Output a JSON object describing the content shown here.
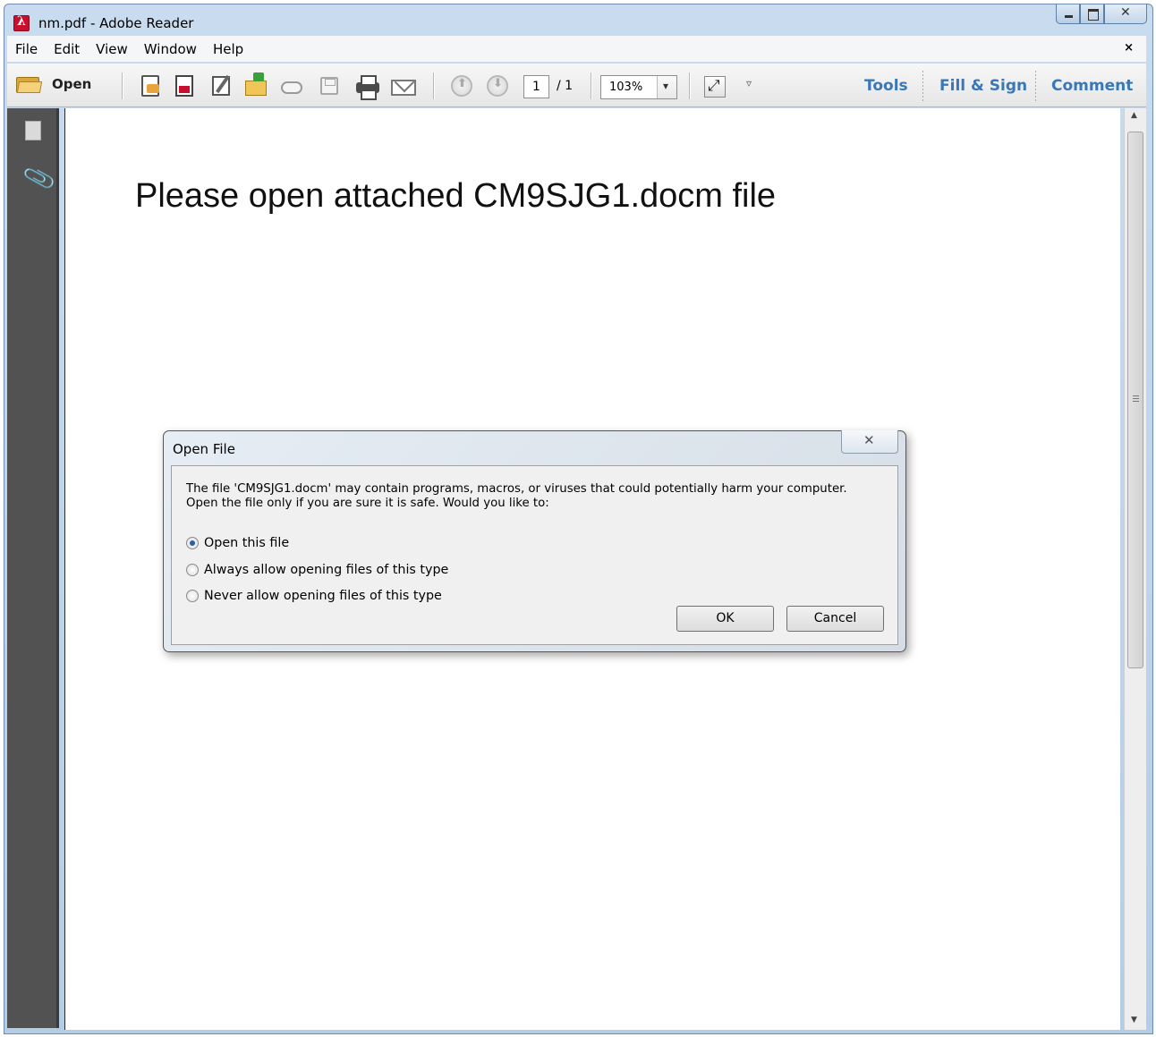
{
  "window": {
    "title": "nm.pdf - Adobe Reader"
  },
  "menu": {
    "items": [
      "File",
      "Edit",
      "View",
      "Window",
      "Help"
    ],
    "close": "×"
  },
  "toolbar": {
    "open_label": "Open",
    "page_current": "1",
    "page_total": "/ 1",
    "zoom": "103%",
    "more": "▿",
    "right_links": [
      "Tools",
      "Fill & Sign",
      "Comment"
    ]
  },
  "document": {
    "text": "Please open attached CM9SJG1.docm file"
  },
  "dialog": {
    "title": "Open File",
    "message_line1": "The file 'CM9SJG1.docm' may contain programs, macros, or viruses that could potentially harm your computer.",
    "message_line2": "Open the file only if you are sure it is safe. Would you like to:",
    "options": [
      {
        "label": "Open this file",
        "checked": true
      },
      {
        "label": "Always allow opening files of this type",
        "checked": false
      },
      {
        "label": "Never allow opening files of this type",
        "checked": false
      }
    ],
    "ok_label": "OK",
    "cancel_label": "Cancel"
  },
  "colors": {
    "link_blue": "#3a77b6",
    "nav_pane": "#525252",
    "title_bar": "#c9dcef"
  }
}
